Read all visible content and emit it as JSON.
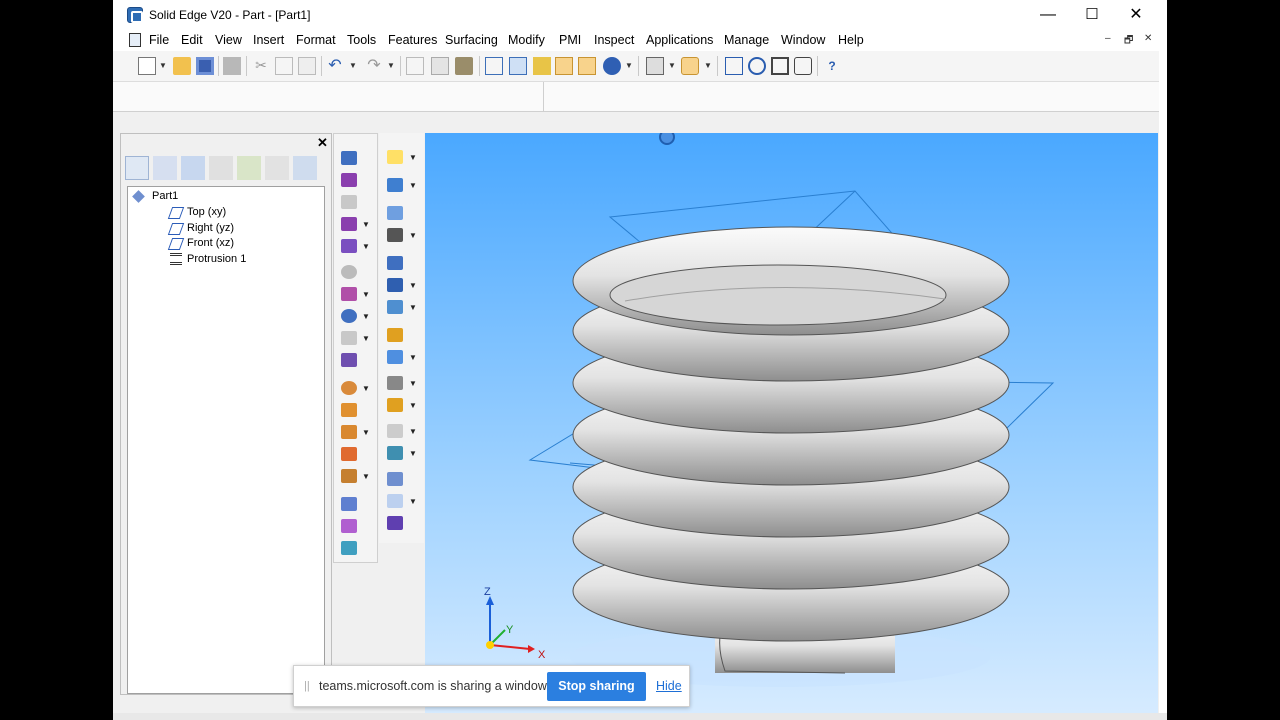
{
  "window": {
    "title": "Solid Edge V20 - Part - [Part1]",
    "controls": {
      "minimize": "—",
      "maximize": "☐",
      "close": "✕"
    }
  },
  "menubar": {
    "items": [
      "File",
      "Edit",
      "View",
      "Insert",
      "Format",
      "Tools",
      "Features",
      "Surfacing",
      "Modify",
      "PMI",
      "Inspect",
      "Applications",
      "Manage",
      "Window",
      "Help"
    ],
    "doc_controls": {
      "minimize": "–",
      "restore": "🗗",
      "close": "✕"
    }
  },
  "toolbar": {
    "icons": [
      "new-icon",
      "open-icon",
      "save-icon",
      "print-icon",
      "cut-icon",
      "copy-icon",
      "paste-icon",
      "undo-icon",
      "redo-icon",
      "sketch-icon",
      "part-view-icon",
      "iso-view-icon",
      "front-view-icon",
      "shaded-icon",
      "shaded-edges-icon",
      "visible-edges-icon",
      "render-icon",
      "view-style-icon",
      "zoom-area-icon",
      "zoom-icon",
      "fit-icon",
      "pan-icon",
      "help-pointer-icon"
    ]
  },
  "pathfinder": {
    "close_label": "✕",
    "tree": {
      "root": "Part1",
      "children": [
        "Top (xy)",
        "Right (yz)",
        "Front (xz)",
        "Protrusion 1"
      ]
    }
  },
  "viewport": {
    "triad": {
      "z": "Z",
      "y": "Y",
      "x": "X"
    },
    "background_top": "#4aa8ff",
    "background_bottom": "#d6ebff"
  },
  "share_bar": {
    "text": "teams.microsoft.com is sharing a window.",
    "stop_label": "Stop sharing",
    "hide_label": "Hide",
    "grip": "||"
  },
  "colors": {
    "accent": "#2b7fe0",
    "active_tool": "#f8d38c",
    "spring": "#d8d8d8"
  }
}
